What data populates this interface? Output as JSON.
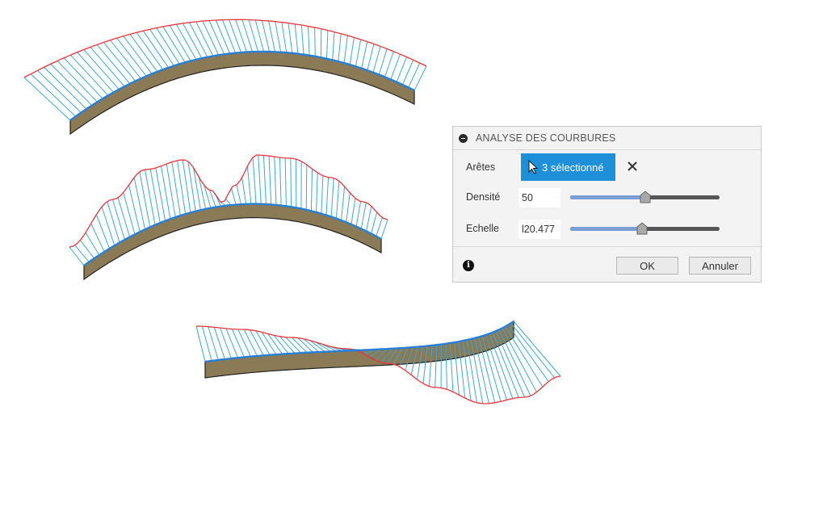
{
  "dialog": {
    "title": "ANALYSE DES COURBURES",
    "aretes_label": "Arêtes",
    "selection_label": "3 sélectionné",
    "densite_label": "Densité",
    "densite_value": "50",
    "densite_fraction": 0.5,
    "echelle_label": "Echelle",
    "echelle_value": "l20.477",
    "echelle_fraction": 0.48,
    "ok_label": "OK",
    "cancel_label": "Annuler",
    "info_glyph": "i"
  },
  "colors": {
    "comb_line": "#3fa6d4",
    "envelope": "#e8343c",
    "edge_highlight": "#2a7fd4",
    "body_fill": "#8a7a55",
    "accent": "#1e8fd9"
  },
  "icons": [
    "collapse-icon",
    "cursor-icon",
    "close-icon",
    "info-icon",
    "slider-thumb-icon"
  ]
}
